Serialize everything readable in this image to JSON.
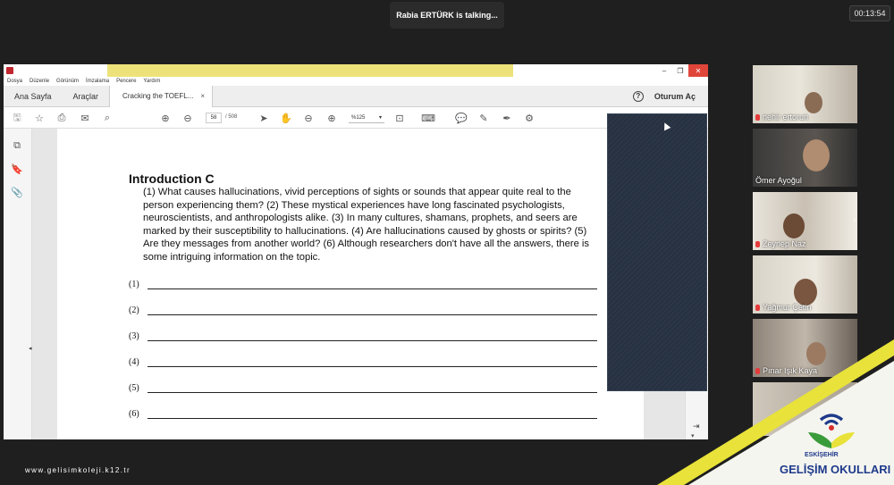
{
  "call": {
    "talking": "Rabia ERTÜRK is talking...",
    "timer": "00:13:54"
  },
  "pdf": {
    "menu": [
      "Dosya",
      "Düzenle",
      "Görünüm",
      "İmzalama",
      "Pencere",
      "Yardım"
    ],
    "tabs": {
      "home": "Ana Sayfa",
      "tools": "Araçlar",
      "doc": "Cracking the TOEFL...",
      "close": "×"
    },
    "login": "Oturum Aç",
    "help": "?",
    "page_current": "58",
    "page_total": "/ 508",
    "zoom": "%125",
    "document": {
      "title": "Introduction C",
      "body": "(1) What causes hallucinations, vivid perceptions of sights or sounds that appear quite real to the person experiencing them? (2) These mystical experiences have long fascinated psychologists, neuroscientists, and anthropologists alike. (3) In many cultures, shamans, prophets, and seers are marked by their susceptibility to hallucinations. (4) Are hallucinations caused by ghosts or spirits? (5) Are they messages from another world? (6) Although researchers don't have all the answers, there is some intriguing information on the topic.",
      "answers": [
        "(1)",
        "(2)",
        "(3)",
        "(4)",
        "(5)",
        "(6)"
      ]
    }
  },
  "participants": [
    {
      "name": "nehir ertorun",
      "muted": true
    },
    {
      "name": "Ömer Ayoğul",
      "muted": false
    },
    {
      "name": "Zeynep Naz",
      "muted": true
    },
    {
      "name": "Yağmur Çetin",
      "muted": true
    },
    {
      "name": "Pınar Işık Kaya",
      "muted": true
    }
  ],
  "branding": {
    "url": "www.gelisimkoleji.k12.tr",
    "city": "ESKİŞEHİR",
    "name": "GELİŞİM OKULLARI",
    "colors": {
      "yellow": "#e8e23a",
      "navy": "#1e3a8a",
      "green": "#3a9b3a",
      "red": "#d62e2e"
    }
  }
}
